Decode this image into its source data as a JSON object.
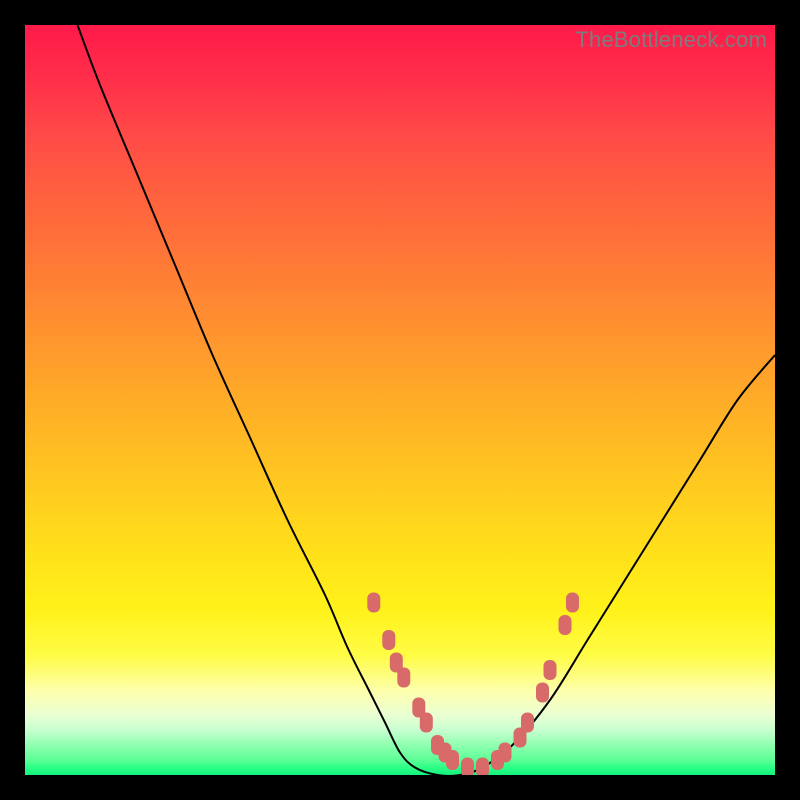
{
  "watermark": "TheBottleneck.com",
  "colors": {
    "page_bg": "#000000",
    "marker": "#d86a6a",
    "curve": "#000000",
    "watermark": "#7c7c7c",
    "gradient_top": "#ff1a4a",
    "gradient_bottom": "#14f27d"
  },
  "chart_data": {
    "type": "line",
    "title": "",
    "xlabel": "",
    "ylabel": "",
    "xlim": [
      0,
      100
    ],
    "ylim": [
      0,
      100
    ],
    "grid": false,
    "legend": false,
    "annotations": [],
    "series": [
      {
        "name": "bottleneck-curve",
        "x": [
          7,
          10,
          15,
          20,
          25,
          30,
          35,
          40,
          43,
          46,
          48,
          50,
          52,
          55,
          58,
          61,
          65,
          70,
          75,
          80,
          85,
          90,
          95,
          100
        ],
        "y": [
          100,
          92,
          80,
          68,
          56,
          45,
          34,
          24,
          17,
          11,
          7,
          3,
          1,
          0,
          0,
          1,
          4,
          10,
          18,
          26,
          34,
          42,
          50,
          56
        ]
      }
    ],
    "markers": [
      {
        "x": 46.5,
        "y": 23
      },
      {
        "x": 48.5,
        "y": 18
      },
      {
        "x": 49.5,
        "y": 15
      },
      {
        "x": 50.5,
        "y": 13
      },
      {
        "x": 52.5,
        "y": 9
      },
      {
        "x": 53.5,
        "y": 7
      },
      {
        "x": 55.0,
        "y": 4
      },
      {
        "x": 56.0,
        "y": 3
      },
      {
        "x": 57.0,
        "y": 2
      },
      {
        "x": 59.0,
        "y": 1
      },
      {
        "x": 61.0,
        "y": 1
      },
      {
        "x": 63.0,
        "y": 2
      },
      {
        "x": 64.0,
        "y": 3
      },
      {
        "x": 66.0,
        "y": 5
      },
      {
        "x": 67.0,
        "y": 7
      },
      {
        "x": 69.0,
        "y": 11
      },
      {
        "x": 70.0,
        "y": 14
      },
      {
        "x": 72.0,
        "y": 20
      },
      {
        "x": 73.0,
        "y": 23
      }
    ]
  }
}
